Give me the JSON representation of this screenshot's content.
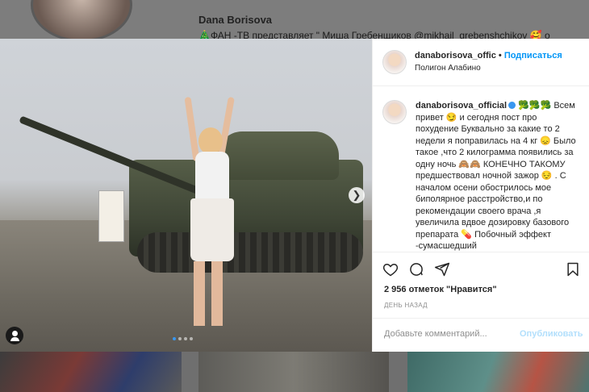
{
  "background": {
    "profile_name": "Dana Borisova",
    "profile_desc": "🎄ФАН -ТВ представляет \" Миша Гребенщиков @mikhail_grebenshchikov 🥰 о"
  },
  "post": {
    "username_short": "danaborisova_offic",
    "follow_label": "Подписаться",
    "separator": " • ",
    "location": "Полигон Алабино",
    "caption_user": "danaborisova_official",
    "caption_emoji": "🥦🥦🥦",
    "caption_text": "Всем привет 😏 и сегодня пост про похудение Буквально за какие то 2 недели я поправилась на 4 кг 😞 Было такое ,что 2 килограмма появились за одну ночь 🙈🙈 КОНЕЧНО ТАКОМУ предшествовал ночной зажор 😔 . С началом осени обострилось мое биполярное расстройство,и по рекомендации своего врача ,я увеличила вдвое дозировку базового препарата 💊 Побочный эффект -сумасшедший",
    "likes": "2 956 отметок \"Нравится\"",
    "time": "ДЕНЬ НАЗАД",
    "comment_placeholder": "Добавьте комментарий...",
    "post_label": "Опубликовать",
    "next_glyph": "❯",
    "carousel_count": 4,
    "carousel_active": 0
  },
  "colors": {
    "accent": "#0095f6",
    "verified": "#3897f0",
    "post_disabled": "#b2dffc"
  }
}
